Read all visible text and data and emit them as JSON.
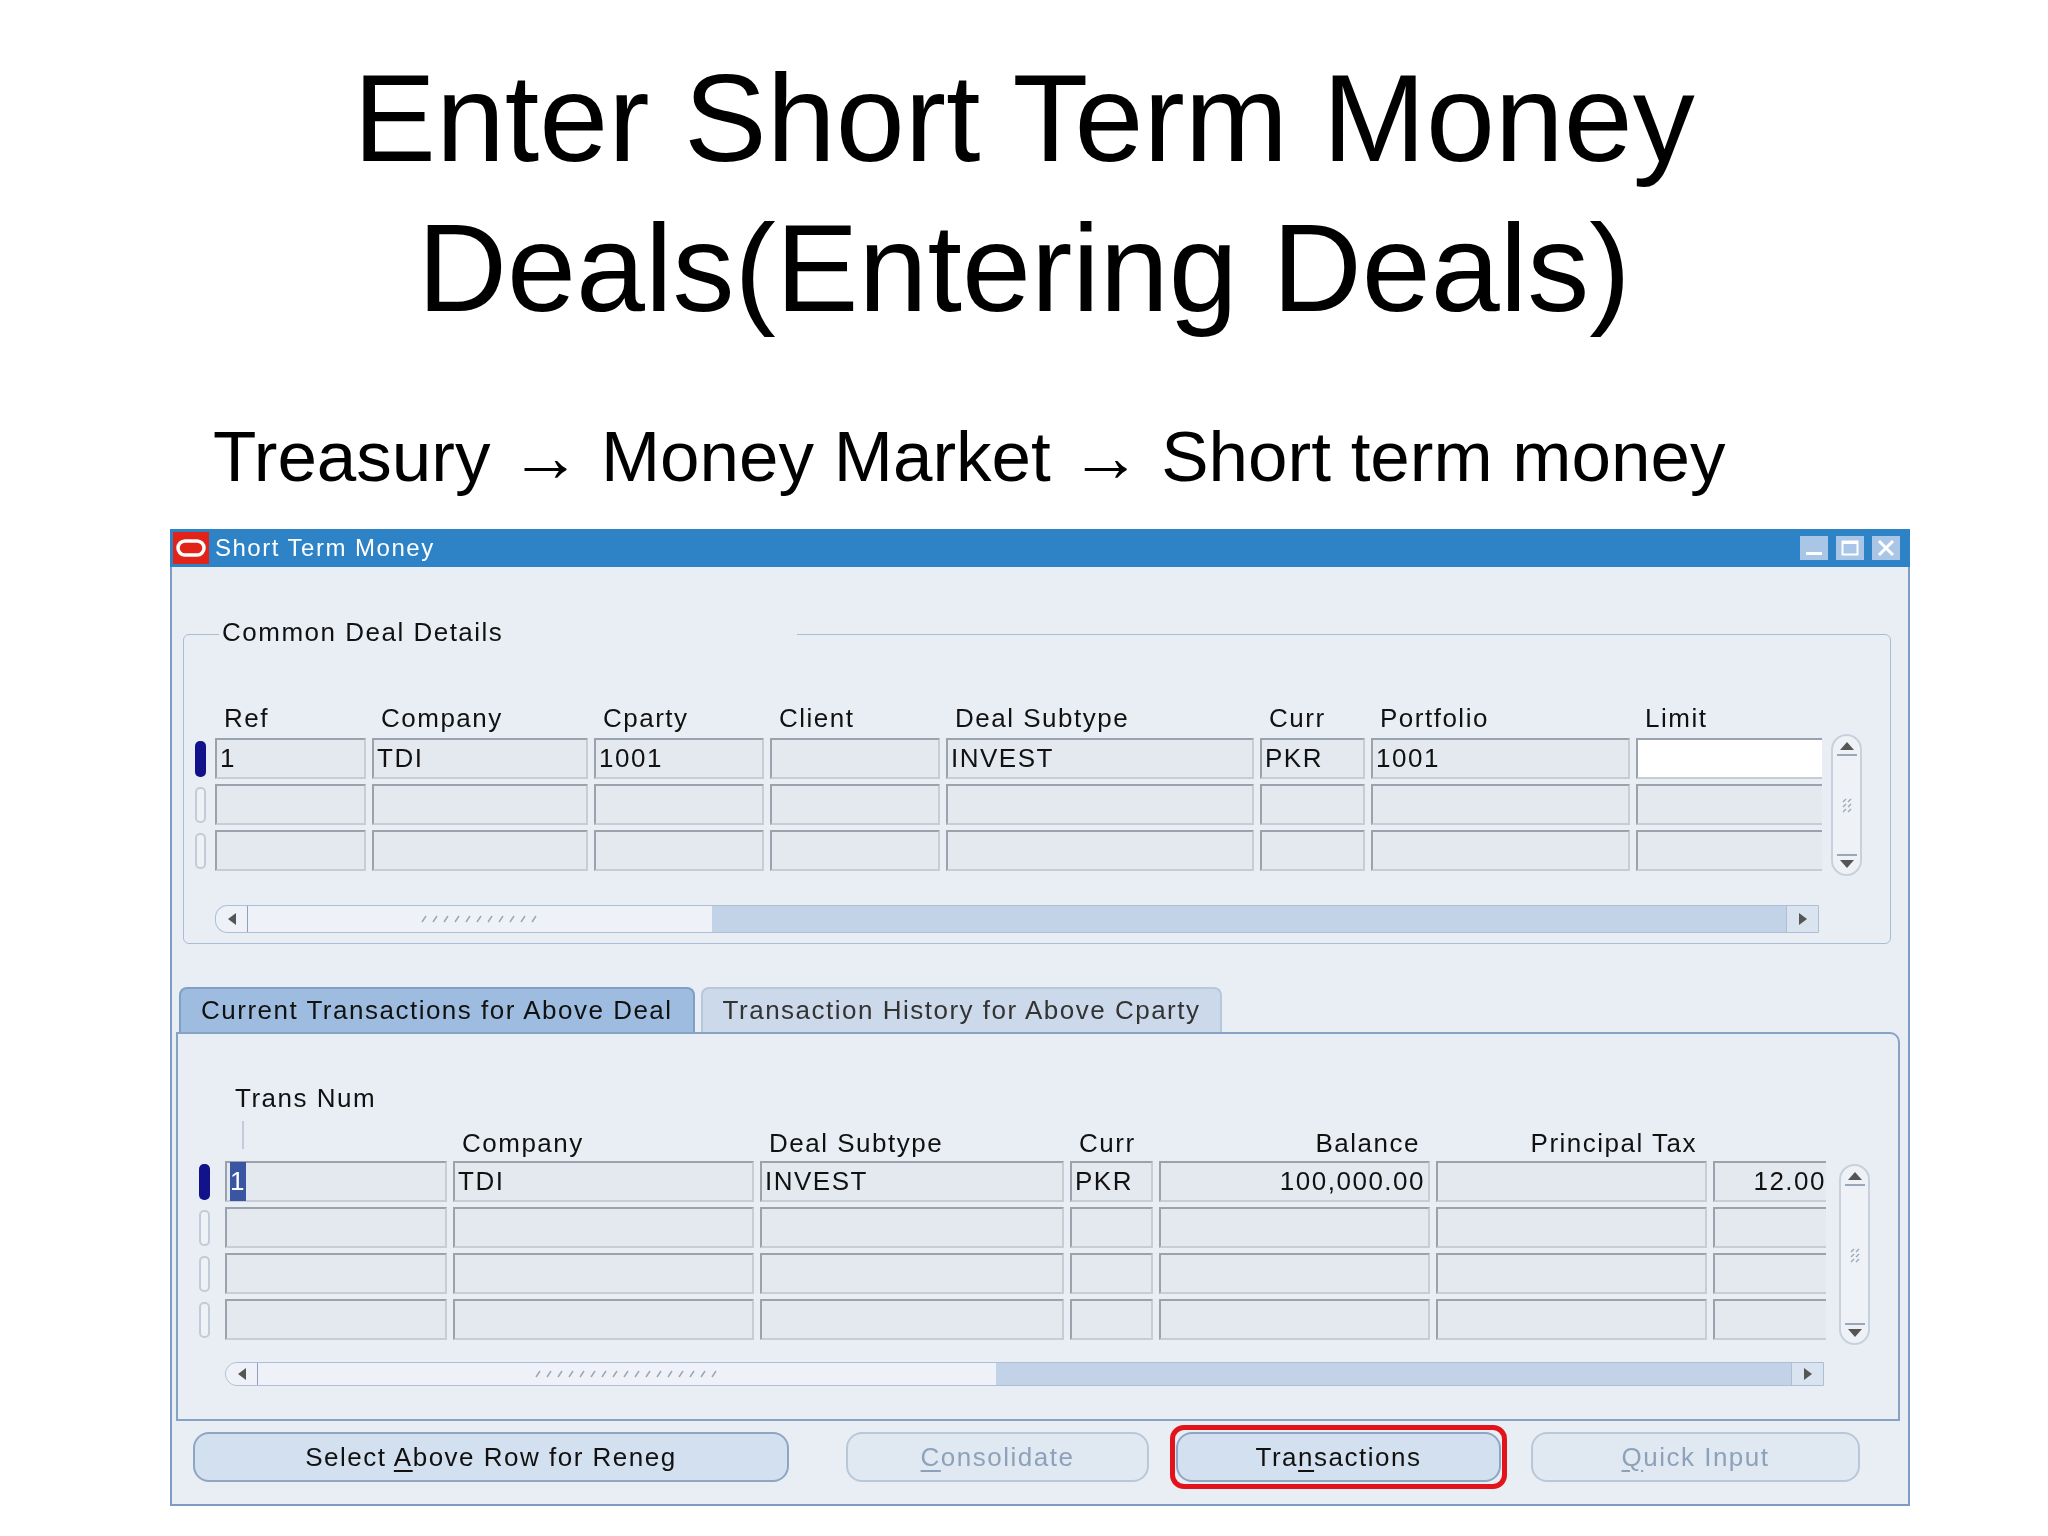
{
  "slide": {
    "title": "Enter Short Term Money Deals(Entering Deals)",
    "subtitle": "Treasury → Money Market → Short term money"
  },
  "window": {
    "title": "Short Term Money"
  },
  "common_deal_details": {
    "title": "Common Deal Details",
    "columns": [
      "Ref",
      "Company",
      "Cparty",
      "Client",
      "Deal Subtype",
      "Curr",
      "Portfolio",
      "Limit"
    ],
    "rows": [
      {
        "selected": true,
        "cells": [
          {
            "value": "1",
            "focused": false
          },
          {
            "value": "TDI",
            "focused": false
          },
          {
            "value": "1001",
            "focused": false
          },
          {
            "focused": false
          },
          {
            "value": "INVEST",
            "focused": false
          },
          {
            "value": "PKR",
            "focused": false
          },
          {
            "value": "1001",
            "focused": false
          },
          {
            "focused": true
          }
        ]
      },
      {
        "selected": false
      },
      {
        "selected": false
      }
    ]
  },
  "tabs": [
    {
      "label": "Current Transactions for Above Deal",
      "selected": true
    },
    {
      "label": "Transaction History for Above Cparty",
      "selected": false
    }
  ],
  "transactions": {
    "columns": [
      "Trans Num",
      "Company",
      "Deal Subtype",
      "Curr",
      "Balance",
      "Principal Tax",
      null
    ],
    "rows": [
      {
        "selected": true,
        "cells": [
          {
            "value": "1",
            "text_selected": true
          },
          {
            "value": "TDI",
            "text_selected": false
          },
          {
            "value": "INVEST",
            "text_selected": false
          },
          {
            "value": "PKR",
            "text_selected": false
          },
          {
            "value": "100,000.00",
            "text_selected": false
          },
          {},
          {
            "value": "12.00",
            "text_selected": false
          }
        ]
      },
      {
        "selected": false
      },
      {
        "selected": false
      },
      {
        "selected": false
      }
    ]
  },
  "buttons": [
    {
      "text_before": "Select ",
      "access_key": "A",
      "text_after": "bove Row for Reneg",
      "disabled": false,
      "highlighted": false
    },
    {
      "access_key": "C",
      "text_after": "onsolidate",
      "disabled": true,
      "highlighted": false
    },
    {
      "text_before": "Tra",
      "access_key": "n",
      "text_after": "sactions",
      "disabled": false,
      "highlighted": true
    },
    {
      "access_key": "Q",
      "text_after": "uick Input",
      "disabled": true,
      "highlighted": false
    }
  ]
}
